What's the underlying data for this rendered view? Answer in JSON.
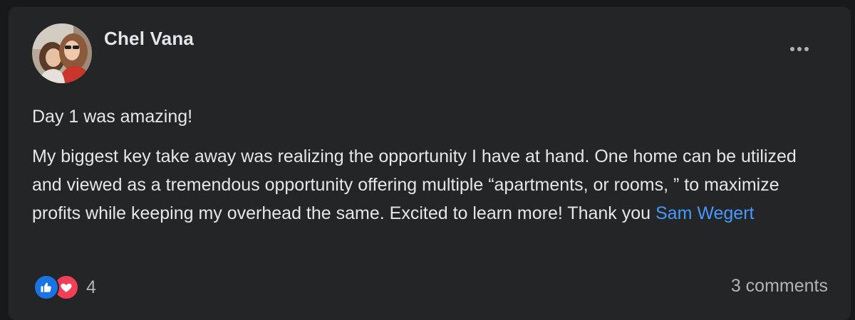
{
  "post": {
    "author": "Chel Vana",
    "paragraphs": [
      "Day 1 was amazing!",
      "My biggest key take away was realizing the opportunity I have at hand. One home can be utilized and viewed as a tremendous opportunity offering multiple “apartments, or rooms, ” to maximize profits while keeping my overhead the same. Excited to learn more! Thank you "
    ],
    "mention": "Sam Wegert",
    "more_icon": "more-options-icon"
  },
  "footer": {
    "reaction_icons": [
      "like-icon",
      "love-icon"
    ],
    "reaction_count": "4",
    "comments_label": "3 comments"
  },
  "colors": {
    "background": "#18191a",
    "card": "#242526",
    "text": "#e4e6eb",
    "secondary_text": "#b0b3b8",
    "mention": "#4599ff",
    "like": "#1b74e4",
    "love": "#f33e58"
  }
}
